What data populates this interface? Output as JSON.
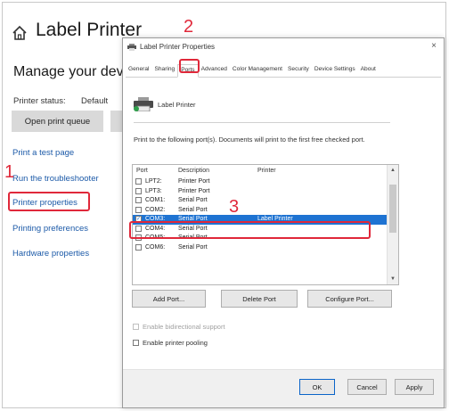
{
  "settings": {
    "title": "Label Printer",
    "manage_heading": "Manage your devi",
    "status_label": "Printer status:",
    "status_value": "Default",
    "open_queue_label": "Open print queue",
    "links": [
      "Print a test page",
      "Run the troubleshooter",
      "Printer properties",
      "Printing preferences",
      "Hardware properties"
    ]
  },
  "dialog": {
    "title": "Label Printer Properties",
    "close_glyph": "×",
    "tabs": [
      "General",
      "Sharing",
      "Ports",
      "Advanced",
      "Color Management",
      "Security",
      "Device Settings",
      "About"
    ],
    "active_tab": "Ports",
    "printer_name": "Label Printer",
    "instructions": "Print to the following port(s). Documents will print to the first free checked port.",
    "port_headers": {
      "port": "Port",
      "description": "Description",
      "printer": "Printer"
    },
    "ports": [
      {
        "port": "LPT2:",
        "description": "Printer Port",
        "printer": "",
        "checked": false
      },
      {
        "port": "LPT3:",
        "description": "Printer Port",
        "printer": "",
        "checked": false
      },
      {
        "port": "COM1:",
        "description": "Serial Port",
        "printer": "",
        "checked": false
      },
      {
        "port": "COM2:",
        "description": "Serial Port",
        "printer": "",
        "checked": false
      },
      {
        "port": "COM3:",
        "description": "Serial Port",
        "printer": "Label Printer",
        "checked": true
      },
      {
        "port": "COM4:",
        "description": "Serial Port",
        "printer": "",
        "checked": false
      },
      {
        "port": "COM5:",
        "description": "Serial Port",
        "printer": "",
        "checked": false
      },
      {
        "port": "COM6:",
        "description": "Serial Port",
        "printer": "",
        "checked": false
      }
    ],
    "buttons": {
      "add_port": "Add Port...",
      "delete_port": "Delete Port",
      "configure_port": "Configure Port..."
    },
    "options": {
      "bidirectional": "Enable bidirectional support",
      "pooling": "Enable printer pooling"
    },
    "footer_buttons": {
      "ok": "OK",
      "cancel": "Cancel",
      "apply": "Apply"
    }
  },
  "annotations": {
    "step1": "1",
    "step2": "2",
    "step3": "3",
    "color": "#e0283a"
  },
  "colors": {
    "link": "#1c5aa8",
    "selection": "#1e73d2",
    "highlight": "#e0283a"
  }
}
